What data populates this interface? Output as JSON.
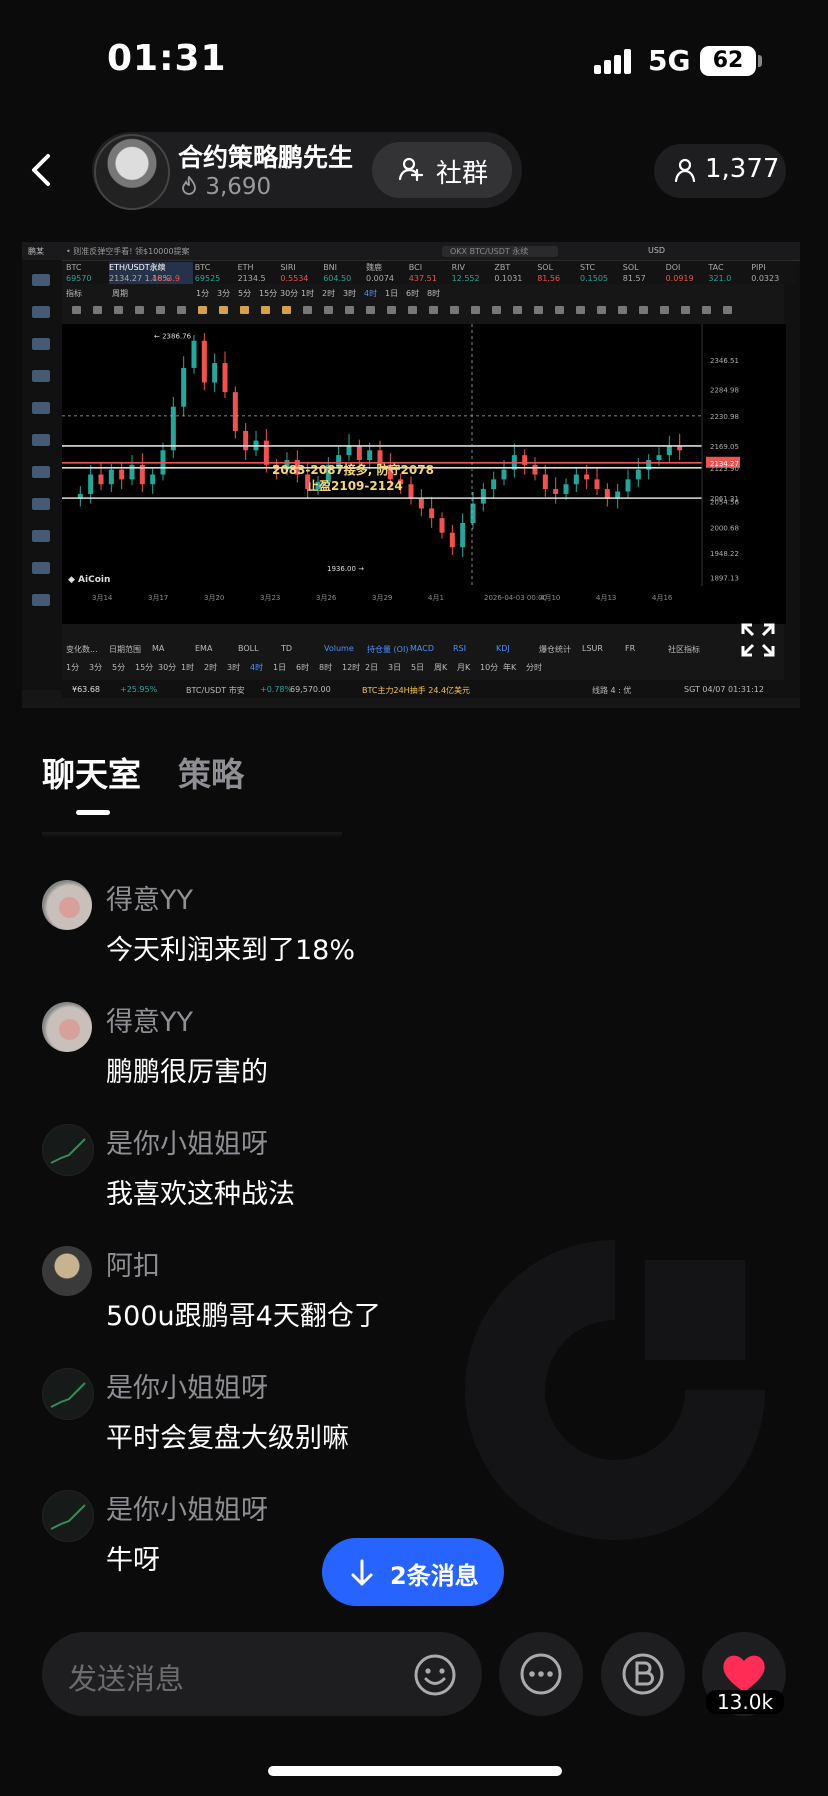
{
  "status_bar": {
    "time": "01:31",
    "network": "5G",
    "battery": "62"
  },
  "header": {
    "host_name": "合约策略鹏先生",
    "host_likes": "3,690",
    "group_label": "社群",
    "viewer_count": "1,377"
  },
  "stream": {
    "tv_title": "鹏某",
    "tv_search": "OKX BTC/USDT 永续",
    "currency": "USD",
    "top_note": "• 则准反弹空手看! 领$10000提案",
    "tickers": [
      {
        "sym": "BTC",
        "val": "69570"
      },
      {
        "sym": "ETH/USDT永续",
        "val": "2134.27 1.18%"
      },
      {
        "sym": "XAI",
        "val": "4653.9"
      },
      {
        "sym": "BTC",
        "val": "69525"
      },
      {
        "sym": "ETH",
        "val": "2134.5"
      },
      {
        "sym": "SIRI",
        "val": "0.5534"
      },
      {
        "sym": "BNI",
        "val": "604.50"
      },
      {
        "sym": "魏鹿",
        "val": "0.0074"
      },
      {
        "sym": "BCI",
        "val": "437.51"
      },
      {
        "sym": "RIV",
        "val": "12.552"
      },
      {
        "sym": "ZBT",
        "val": "0.1031"
      },
      {
        "sym": "SOL",
        "val": "81.56"
      },
      {
        "sym": "STC",
        "val": "0.1505"
      },
      {
        "sym": "SOL",
        "val": "81.57"
      },
      {
        "sym": "DOI",
        "val": "0.0919"
      },
      {
        "sym": "TAC",
        "val": "321.0"
      },
      {
        "sym": "PIPI",
        "val": "0.0323"
      }
    ],
    "toolbar_items": [
      "指标",
      "周期",
      "1分",
      "3分",
      "5分",
      "15分",
      "30分",
      "1时",
      "2时",
      "3时",
      "4时",
      "1日",
      "6时",
      "8时"
    ],
    "price_high": "2386.76",
    "price_low": "1936.00",
    "annotation_line1": "2083-2087接多, 防守2078",
    "annotation_line2": "止盈2109-2124",
    "price_scale": [
      "2346.51",
      "2284.98",
      "2230.98",
      "2169.05",
      "2134.27",
      "2123.90",
      "2061.31",
      "2054.56",
      "2000.68",
      "1948.22",
      "1897.13"
    ],
    "dates": [
      "3月14",
      "3月17",
      "3月20",
      "3月23",
      "3月26",
      "3月29",
      "4月1",
      "2026-04-03 00:00",
      "4月10",
      "4月13",
      "4月16"
    ],
    "indicator_tabs": [
      "变化数...",
      "日期范围",
      "MA",
      "EMA",
      "BOLL",
      "TD",
      "Volume",
      "持仓量 (OI)",
      "MACD",
      "RSI",
      "KDJ",
      "爆仓统计",
      "LSUR",
      "FR",
      "社区指标"
    ],
    "timeframes": [
      "1分",
      "3分",
      "5分",
      "15分",
      "30分",
      "1时",
      "2时",
      "3时",
      "4时",
      "1日",
      "6时",
      "8时",
      "12时",
      "2日",
      "3日",
      "5日",
      "周K",
      "月K",
      "10分",
      "年K",
      "分时"
    ],
    "footer_left": "¥63.68",
    "footer_change": "+25.95%",
    "footer_pair": "BTC/USDT 市安",
    "footer_pair_change": "+0.78%",
    "footer_pair_price": "69,570.00",
    "footer_main": "BTC主力24H抽手 24.4亿美元",
    "footer_right": "线路 4 : 优",
    "footer_time": "SGT 04/07 01:31:12",
    "brand": "AiCoin"
  },
  "tabs": {
    "chat": "聊天室",
    "strategy": "策略"
  },
  "messages": [
    {
      "name": "得意YY",
      "text": "今天利润来到了18%",
      "avatar": "yy"
    },
    {
      "name": "得意YY",
      "text": "鹏鹏很厉害的",
      "avatar": "yy"
    },
    {
      "name": "是你小姐姐呀",
      "text": "我喜欢这种战法",
      "avatar": "jie"
    },
    {
      "name": "阿扣",
      "text": "500u跟鹏哥4天翻仓了",
      "avatar": "kou"
    },
    {
      "name": "是你小姐姐呀",
      "text": "平时会复盘大级别嘛",
      "avatar": "jie"
    },
    {
      "name": "是你小姐姐呀",
      "text": "牛呀",
      "avatar": "jie"
    }
  ],
  "new_messages": "2条消息",
  "input": {
    "placeholder": "发送消息"
  },
  "likes": "13.0k",
  "colors": {
    "accent": "#2764ff",
    "like": "#ff2d55",
    "up": "#26a69a",
    "down": "#ef5350"
  },
  "icons": [
    "back-icon",
    "flame-icon",
    "group-icon",
    "person-icon",
    "expand-icon",
    "emoji-icon",
    "more-icon",
    "coin-icon",
    "heart-icon",
    "down-arrow-icon"
  ]
}
